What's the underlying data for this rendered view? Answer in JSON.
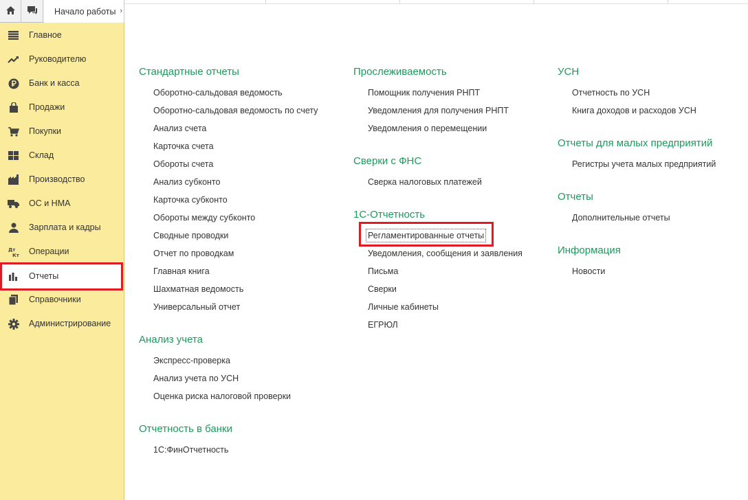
{
  "toolbar": {
    "home_icon": "home-icon",
    "messages_icon": "messages-icon",
    "start_tab_label": "Начало работы"
  },
  "sidebar": {
    "items": [
      {
        "label": "Главное",
        "icon": "menu-icon"
      },
      {
        "label": "Руководителю",
        "icon": "trend-up-icon"
      },
      {
        "label": "Банк и касса",
        "icon": "ruble-coin-icon"
      },
      {
        "label": "Продажи",
        "icon": "shopping-bag-icon"
      },
      {
        "label": "Покупки",
        "icon": "cart-icon"
      },
      {
        "label": "Склад",
        "icon": "warehouse-grid-icon"
      },
      {
        "label": "Производство",
        "icon": "factory-icon"
      },
      {
        "label": "ОС и НМА",
        "icon": "truck-icon"
      },
      {
        "label": "Зарплата и кадры",
        "icon": "person-icon"
      },
      {
        "label": "Операции",
        "icon": "debit-credit-icon"
      },
      {
        "label": "Отчеты",
        "icon": "bar-chart-icon",
        "active": true
      },
      {
        "label": "Справочники",
        "icon": "books-icon"
      },
      {
        "label": "Администрирование",
        "icon": "gear-icon"
      }
    ]
  },
  "sections": {
    "standard_reports": {
      "title": "Стандартные отчеты",
      "links": [
        "Оборотно-сальдовая ведомость",
        "Оборотно-сальдовая ведомость по счету",
        "Анализ счета",
        "Карточка счета",
        "Обороты счета",
        "Анализ субконто",
        "Карточка субконто",
        "Обороты между субконто",
        "Сводные проводки",
        "Отчет по проводкам",
        "Главная книга",
        "Шахматная ведомость",
        "Универсальный отчет"
      ]
    },
    "accounting_analysis": {
      "title": "Анализ учета",
      "links": [
        "Экспресс-проверка",
        "Анализ учета по УСН",
        "Оценка риска налоговой проверки"
      ]
    },
    "bank_reporting": {
      "title": "Отчетность в банки",
      "links": [
        "1С:ФинОтчетность"
      ]
    },
    "traceability": {
      "title": "Прослеживаемость",
      "links": [
        "Помощник получения РНПТ",
        "Уведомления для получения РНПТ",
        "Уведомления о перемещении"
      ]
    },
    "fns_reconciliation": {
      "title": "Сверки с ФНС",
      "links": [
        "Сверка налоговых платежей"
      ]
    },
    "one_c_reporting": {
      "title": "1С-Отчетность",
      "links": [
        "Регламентированные отчеты",
        "Уведомления, сообщения и заявления",
        "Письма",
        "Сверки",
        "Личные кабинеты",
        "ЕГРЮЛ"
      ]
    },
    "usn": {
      "title": "УСН",
      "links": [
        "Отчетность по УСН",
        "Книга доходов и расходов УСН"
      ]
    },
    "small_business": {
      "title": "Отчеты для малых предприятий",
      "links": [
        "Регистры учета малых предприятий"
      ]
    },
    "reports": {
      "title": "Отчеты",
      "links": [
        "Дополнительные отчеты"
      ]
    },
    "info": {
      "title": "Информация",
      "links": [
        "Новости"
      ]
    }
  },
  "colors": {
    "sidebar_bg": "#fbeb9c",
    "section_title": "#1b9a5c",
    "highlight": "#e01b24"
  }
}
